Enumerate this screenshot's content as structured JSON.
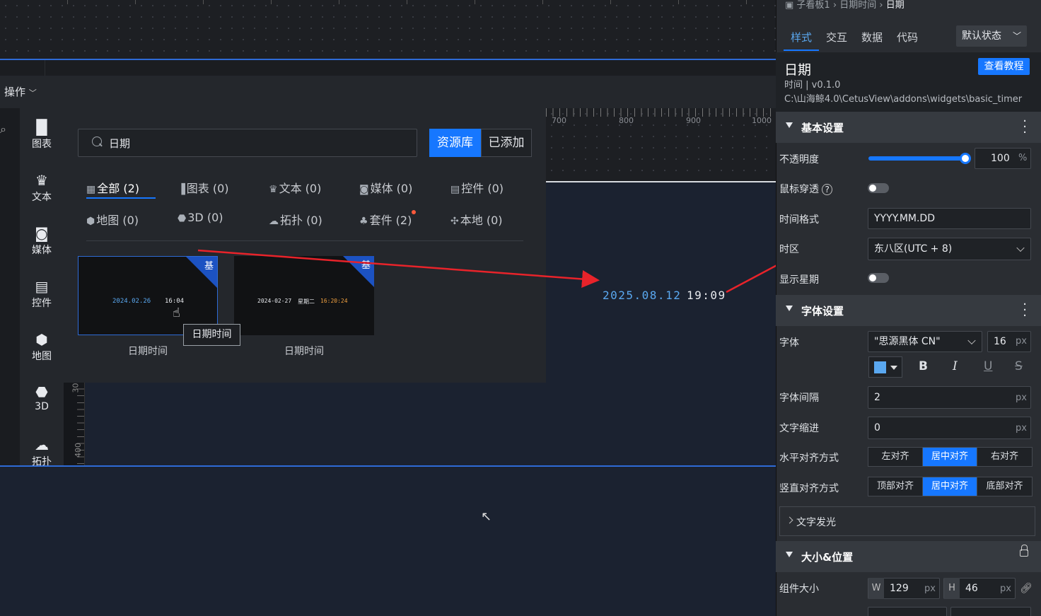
{
  "toolbar": {
    "ops_label": "操作",
    "ops_chevron": "chevron-down-icon"
  },
  "canvas": {
    "ruler_labels": [
      "700",
      "800",
      "900",
      "1000"
    ],
    "vruler_labels": [
      "30",
      "400"
    ],
    "preview_date": "2025.08.12",
    "preview_time": "19:09",
    "date_color": "#5aa8f0",
    "guide_color": "#2e6bd6",
    "arrow_color": "#e8232a"
  },
  "categories": [
    {
      "label": "图表",
      "icon": "bar-chart-icon"
    },
    {
      "label": "文本",
      "icon": "text-icon"
    },
    {
      "label": "媒体",
      "icon": "media-icon"
    },
    {
      "label": "控件",
      "icon": "control-icon"
    },
    {
      "label": "地图",
      "icon": "map-icon"
    },
    {
      "label": "3D",
      "icon": "cube-icon"
    },
    {
      "label": "拓扑",
      "icon": "topology-icon"
    }
  ],
  "resource": {
    "search_value": "日期",
    "library_btn": "资源库",
    "added_btn": "已添加",
    "tabs": [
      {
        "label": "全部 (2)",
        "icon": "grid-icon"
      },
      {
        "label": "图表 (0)",
        "icon": "bar-chart-icon"
      },
      {
        "label": "文本 (0)",
        "icon": "text-icon"
      },
      {
        "label": "媒体 (0)",
        "icon": "media-icon"
      },
      {
        "label": "控件 (0)",
        "icon": "control-icon"
      },
      {
        "label": "地图 (0)",
        "icon": "map-icon"
      },
      {
        "label": "3D (0)",
        "icon": "cube-icon"
      },
      {
        "label": "拓扑 (0)",
        "icon": "topology-icon"
      },
      {
        "label": "套件 (2)",
        "icon": "suite-icon"
      },
      {
        "label": "本地 (0)",
        "icon": "puzzle-icon"
      }
    ],
    "cards": [
      {
        "badge": "基",
        "date": "2024.02.26",
        "time": "16:04",
        "label": "日期时间"
      },
      {
        "badge": "基",
        "date": "2024-02-27",
        "weekday": "星期二",
        "time": "16:20:24",
        "label": "日期时间"
      }
    ],
    "tooltip": "日期时间",
    "accent": "#1677ff"
  },
  "panel": {
    "breadcrumb": [
      "子看板1",
      "日期时间",
      "日期"
    ],
    "tabs": [
      "样式",
      "交互",
      "数据",
      "代码"
    ],
    "state_select": "默认状态",
    "widget_title": "日期",
    "tutorial_btn": "查看教程",
    "widget_version": "时间 | v0.1.0",
    "widget_path": "C:\\山海鲸4.0\\CetusView\\addons\\widgets\\basic_timer",
    "basic": {
      "title": "基本设置",
      "opacity_label": "不透明度",
      "opacity_value": "100",
      "opacity_unit": "%",
      "opacity_fraction": 1.0,
      "mouse_through_label": "鼠标穿透",
      "time_format_label": "时间格式",
      "time_format_value": "YYYY.MM.DD",
      "timezone_label": "时区",
      "timezone_value": "东八区(UTC + 8)",
      "show_week_label": "显示星期"
    },
    "font": {
      "title": "字体设置",
      "font_label": "字体",
      "font_value": "\"思源黑体 CN\"",
      "font_size": "16",
      "px": "px",
      "color": "#5aa8f0",
      "bold": "B",
      "italic": "I",
      "underline": "U",
      "strike": "S",
      "spacing_label": "字体间隔",
      "spacing_value": "2",
      "indent_label": "文字缩进",
      "indent_value": "0",
      "halign_label": "水平对齐方式",
      "halign_options": [
        "左对齐",
        "居中对齐",
        "右对齐"
      ],
      "valign_label": "竖直对齐方式",
      "valign_options": [
        "顶部对齐",
        "居中对齐",
        "底部对齐"
      ],
      "glow_label": "文字发光"
    },
    "size": {
      "title": "大小&位置",
      "size_label": "组件大小",
      "w_tag": "W",
      "w_value": "129",
      "h_tag": "H",
      "h_value": "46",
      "px": "px"
    }
  }
}
